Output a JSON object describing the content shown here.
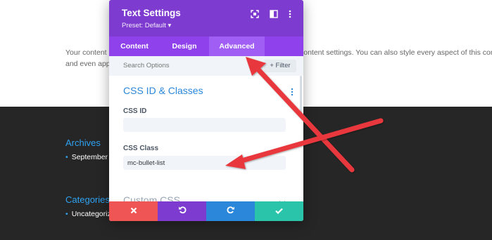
{
  "background": {
    "content_line1_part1": "Your content",
    "content_line1_part2": "content settings. You can also style every aspect of this content",
    "content_line2": "and even app",
    "widgets": [
      {
        "title": "Archives",
        "item": "September"
      },
      {
        "title": "Categories",
        "item": "Uncategoriz"
      }
    ]
  },
  "modal": {
    "title": "Text Settings",
    "preset": "Preset: Default ▾",
    "tabs": [
      {
        "label": "Content",
        "active": false
      },
      {
        "label": "Design",
        "active": false
      },
      {
        "label": "Advanced",
        "active": true
      }
    ],
    "search": {
      "placeholder": "Search Options",
      "filter_label": "+ Filter"
    },
    "section": {
      "title": "CSS ID & Classes",
      "css_id_label": "CSS ID",
      "css_id_value": "",
      "css_class_label": "CSS Class",
      "css_class_value": "mc-bullet-list"
    },
    "section2": {
      "title": "Custom CSS"
    },
    "footer": {
      "buttons": [
        {
          "name": "cancel",
          "icon": "close-icon",
          "color": "#ef5555"
        },
        {
          "name": "undo",
          "icon": "undo-icon",
          "color": "#7e3bd0"
        },
        {
          "name": "redo",
          "icon": "redo-icon",
          "color": "#2b87da"
        },
        {
          "name": "save",
          "icon": "check-icon",
          "color": "#29c4a9"
        }
      ]
    }
  },
  "colors": {
    "header": "#7e3bd0",
    "tabs_bar": "#8f42ec",
    "tab_active": "#a05ef5",
    "section_title": "#2b87da",
    "arrow": "#e8383d",
    "dark_footer": "#262626"
  }
}
